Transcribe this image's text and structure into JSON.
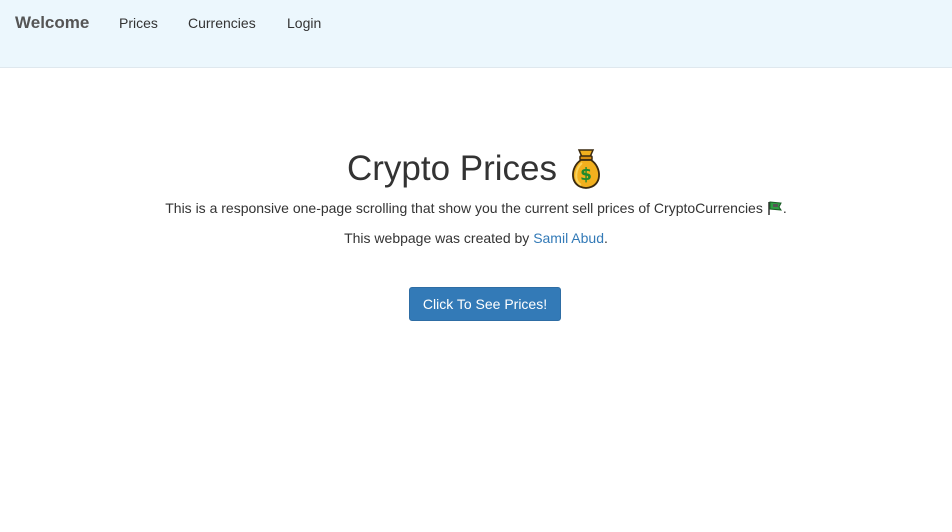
{
  "navbar": {
    "brand": "Welcome",
    "links": [
      "Prices",
      "Currencies",
      "Login"
    ]
  },
  "hero": {
    "title": "Crypto Prices",
    "title_icon": "money-bag-icon",
    "description": "This is a responsive one-page scrolling that show you the current sell prices of CryptoCurrencies",
    "description_icon": "flag-icon",
    "description_end": ".",
    "credit_prefix": "This webpage was created by ",
    "author": "Samil Abud",
    "credit_suffix": ".",
    "button_label": "Click To See Prices!"
  },
  "colors": {
    "navbar_bg": "#ecf7fd",
    "link": "#337ab7",
    "button_bg": "#337ab7"
  }
}
